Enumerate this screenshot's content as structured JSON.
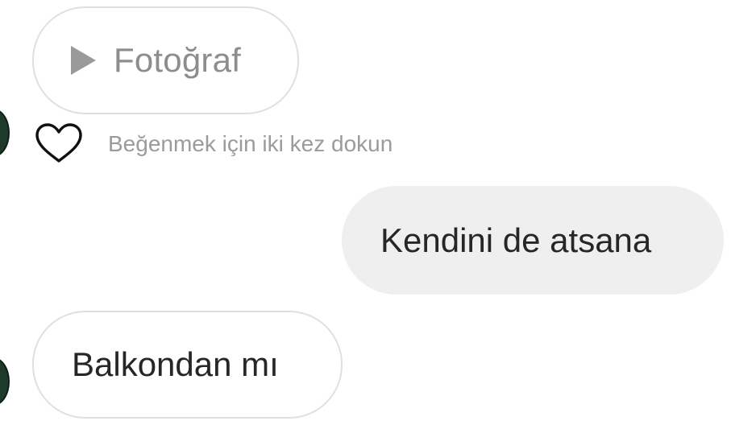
{
  "messages": {
    "photo_message": {
      "label": "Fotoğraf",
      "icon": "play-icon"
    },
    "like_hint": {
      "text": "Beğenmek için iki kez dokun",
      "icon": "heart-outline-icon"
    },
    "outgoing_message": {
      "text": "Kendini de atsana"
    },
    "incoming_message": {
      "text": "Balkondan mı"
    }
  },
  "colors": {
    "outgoing_bubble": "#efefef",
    "incoming_border": "#e0e0e0",
    "muted_text": "#8d8d8d",
    "primary_text": "#262626"
  }
}
